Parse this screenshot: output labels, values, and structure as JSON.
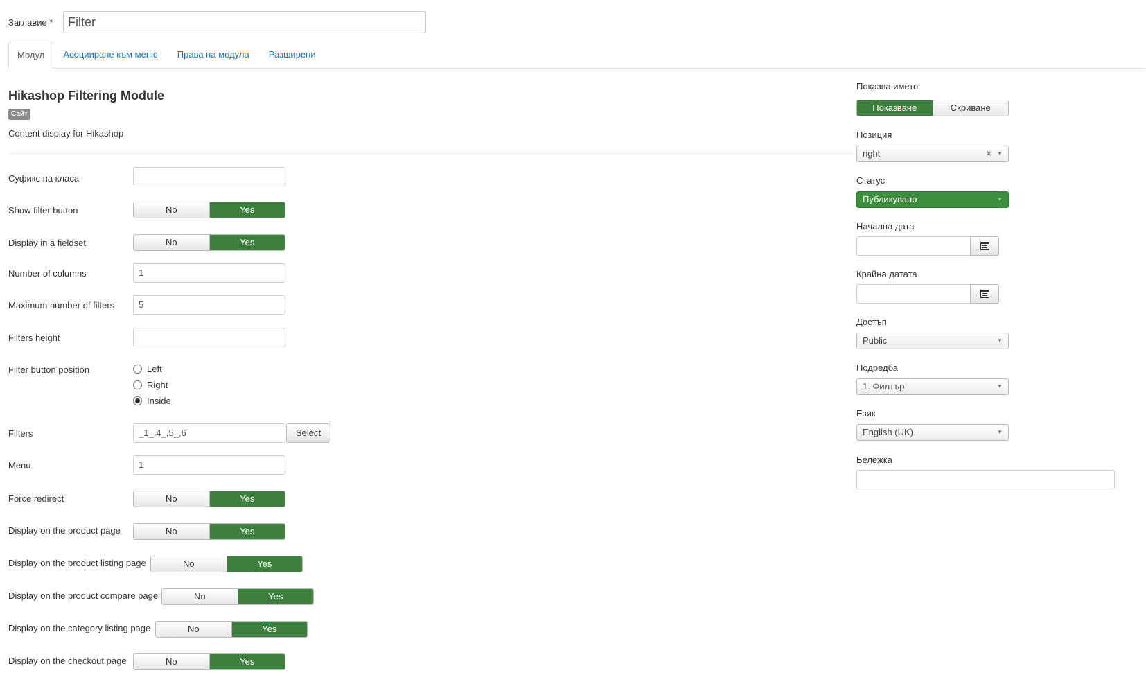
{
  "title": {
    "label": "Заглавие *",
    "value": "Filter"
  },
  "tabs": [
    {
      "label": "Модул",
      "active": true
    },
    {
      "label": "Асоцииране към меню",
      "active": false
    },
    {
      "label": "Права на модула",
      "active": false
    },
    {
      "label": "Разширени",
      "active": false
    }
  ],
  "module": {
    "name": "Hikashop Filtering Module",
    "badge": "Сайт",
    "description": "Content display for Hikashop"
  },
  "fields": {
    "class_suffix": {
      "label": "Суфикс на класа",
      "value": ""
    },
    "show_filter_button": {
      "label": "Show filter button",
      "no": "No",
      "yes": "Yes"
    },
    "display_fieldset": {
      "label": "Display in a fieldset",
      "no": "No",
      "yes": "Yes"
    },
    "num_columns": {
      "label": "Number of columns",
      "value": "1"
    },
    "max_filters": {
      "label": "Maximum number of filters",
      "value": "5"
    },
    "filters_height": {
      "label": "Filters height",
      "value": ""
    },
    "filter_button_position": {
      "label": "Filter button position",
      "options": [
        "Left",
        "Right",
        "Inside"
      ],
      "selected": "Inside"
    },
    "filters": {
      "label": "Filters",
      "value": "_1_,4_,5_,6",
      "select_label": "Select"
    },
    "menu": {
      "label": "Menu",
      "value": "1"
    },
    "force_redirect": {
      "label": "Force redirect",
      "no": "No",
      "yes": "Yes"
    },
    "product_page": {
      "label": "Display on the product page",
      "no": "No",
      "yes": "Yes"
    },
    "product_listing": {
      "label": "Display on the product listing page",
      "no": "No",
      "yes": "Yes"
    },
    "product_compare": {
      "label": "Display on the product compare page",
      "no": "No",
      "yes": "Yes"
    },
    "category_listing": {
      "label": "Display on the category listing page",
      "no": "No",
      "yes": "Yes"
    },
    "checkout_page": {
      "label": "Display on the checkout page",
      "no": "No",
      "yes": "Yes"
    }
  },
  "sidebar": {
    "show_title": {
      "label": "Показва името",
      "show": "Показване",
      "hide": "Скриване"
    },
    "position": {
      "label": "Позиция",
      "value": "right"
    },
    "status": {
      "label": "Статус",
      "value": "Публикувано"
    },
    "start_date": {
      "label": "Начална дата",
      "value": ""
    },
    "end_date": {
      "label": "Крайна датата",
      "value": ""
    },
    "access": {
      "label": "Достъп",
      "value": "Public"
    },
    "ordering": {
      "label": "Подредба",
      "value": "1. Филтър"
    },
    "language": {
      "label": "Език",
      "value": "English (UK)"
    },
    "note": {
      "label": "Бележка",
      "value": ""
    }
  },
  "colors": {
    "accent_green": "#3d7f3d",
    "link_blue": "#1a72b8"
  }
}
